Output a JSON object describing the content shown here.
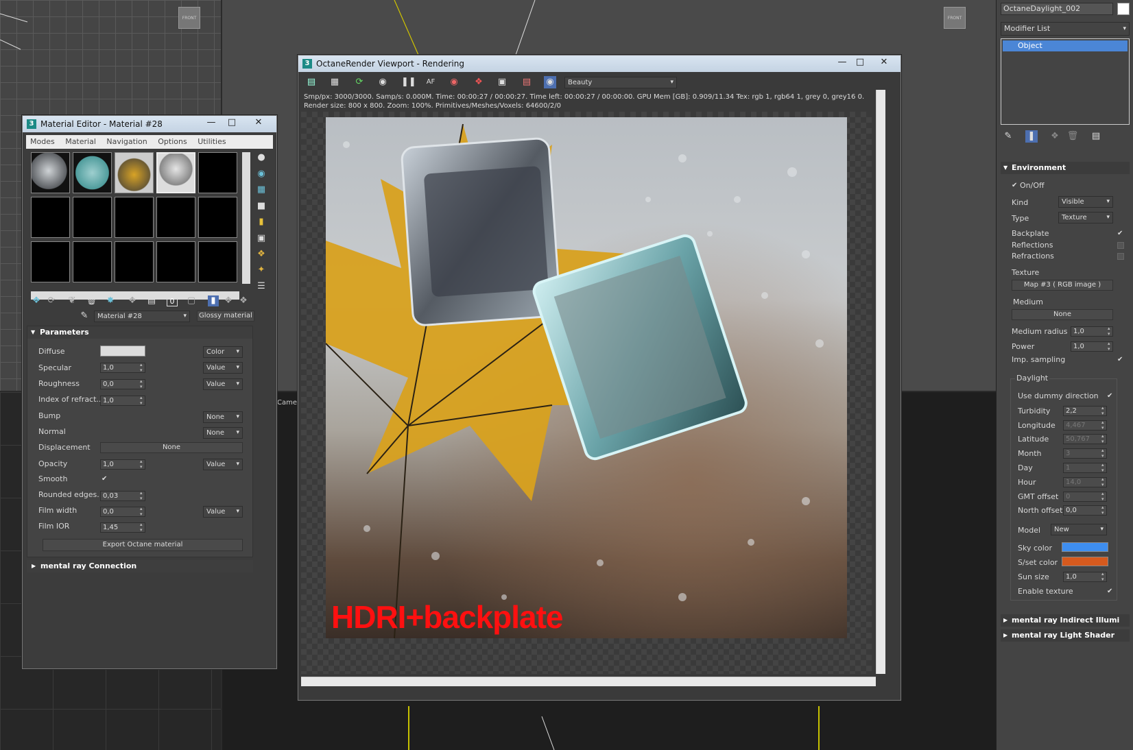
{
  "background": {
    "front_label": "FRONT",
    "camera_label": "Camera"
  },
  "material_editor": {
    "title": "Material Editor - Material #28",
    "menu": [
      "Modes",
      "Material",
      "Navigation",
      "Options",
      "Utilities"
    ],
    "material_name": "Material #28",
    "material_type": "Glossy material",
    "sections": {
      "parameters": "Parameters",
      "mental_ray": "mental ray Connection"
    },
    "params": {
      "diffuse": "Diffuse",
      "diffuse_mode": "Color",
      "specular": "Specular",
      "specular_value": "1,0",
      "specular_mode": "Value",
      "roughness": "Roughness",
      "roughness_value": "0,0",
      "roughness_mode": "Value",
      "ior": "Index of refract...",
      "ior_value": "1,0",
      "bump": "Bump",
      "bump_mode": "None",
      "normal": "Normal",
      "normal_mode": "None",
      "displacement": "Displacement",
      "displacement_value": "None",
      "opacity": "Opacity",
      "opacity_value": "1,0",
      "opacity_mode": "Value",
      "smooth": "Smooth",
      "smooth_check": "✔",
      "rounded": "Rounded edges...",
      "rounded_value": "0,03",
      "film_width": "Film width",
      "film_width_value": "0,0",
      "film_width_mode": "Value",
      "film_ior": "Film IOR",
      "film_ior_value": "1,45"
    },
    "export_button": "Export Octane material"
  },
  "octane": {
    "title": "OctaneRender Viewport - Rendering",
    "pass": "Beauty",
    "stats_line1": "Smp/px: 3000/3000.  Samp/s: 0.000M.  Time: 00:00:27 / 00:00:27.  Time left: 00:00:27 / 00:00:00.  GPU Mem [GB]: 0.909/11.34  Tex: rgb 1, rgb64 1, grey 0, grey16 0.",
    "stats_line2": "Render size: 800 x 800.  Zoom: 100%.  Primitives/Meshes/Voxels: 64600/2/0",
    "overlay_text": "HDRI+backplate"
  },
  "command_panel": {
    "object_name": "OctaneDaylight_002",
    "modifier_list": "Modifier List",
    "stack_item": "Object",
    "environment": {
      "title": "Environment",
      "onoff": "On/Off",
      "kind_label": "Kind",
      "kind_value": "Visible",
      "type_label": "Type",
      "type_value": "Texture",
      "backplate": "Backplate",
      "reflections": "Reflections",
      "refractions": "Refractions",
      "texture_label": "Texture",
      "texture_value": "Map #3  ( RGB image )",
      "medium_label": "Medium",
      "medium_value": "None",
      "medium_radius": "Medium radius",
      "medium_radius_value": "1,0",
      "power": "Power",
      "power_value": "1,0",
      "imp_sampling": "Imp. sampling"
    },
    "daylight": {
      "title": "Daylight",
      "use_dummy": "Use dummy direction",
      "turbidity": "Turbidity",
      "turbidity_value": "2,2",
      "longitude": "Longitude",
      "longitude_value": "4,467",
      "latitude": "Latitude",
      "latitude_value": "50,767",
      "month": "Month",
      "month_value": "3",
      "day": "Day",
      "day_value": "1",
      "hour": "Hour",
      "hour_value": "14,0",
      "gmt": "GMT offset",
      "gmt_value": "0",
      "north": "North offset",
      "north_value": "0,0",
      "model": "Model",
      "model_value": "New",
      "sky_color": "Sky color",
      "sky_color_hex": "#3e8ef0",
      "sunset_color": "S/set color",
      "sunset_color_hex": "#d65a1e",
      "sun_size": "Sun size",
      "sun_size_value": "1,0",
      "enable_texture": "Enable texture"
    },
    "rollouts": [
      "mental ray Indirect Illumi",
      "mental ray Light Shader"
    ]
  }
}
